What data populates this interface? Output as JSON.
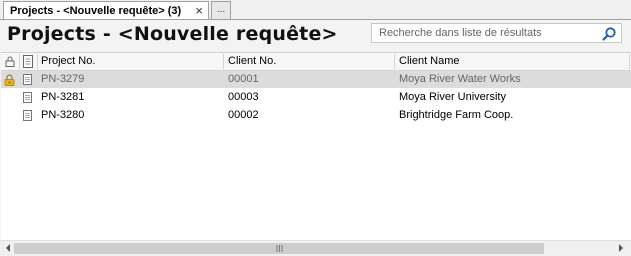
{
  "tab": {
    "label": "Projects - <Nouvelle requête> (3)",
    "close_glyph": "×",
    "more_glyph": "..."
  },
  "header": {
    "title": "Projects - <Nouvelle requête>"
  },
  "search": {
    "placeholder": "Recherche dans liste de résultats"
  },
  "grid": {
    "columns": {
      "lock": "lock-icon",
      "doc": "document-icon",
      "project_no": "Project No.",
      "client_no": "Client No.",
      "client_name": "Client Name"
    },
    "rows": [
      {
        "project_no": "PN-3279",
        "client_no": "00001",
        "client_name": "Moya River Water Works",
        "locked": true,
        "selected": true
      },
      {
        "project_no": "PN-3281",
        "client_no": "00003",
        "client_name": "Moya River University",
        "locked": false,
        "selected": false
      },
      {
        "project_no": "PN-3280",
        "client_no": "00002",
        "client_name": "Brightridge Farm Coop.",
        "locked": false,
        "selected": false
      }
    ]
  },
  "colors": {
    "selected_row": "#dcdcdc",
    "lock_icon": "#d9a520",
    "search_icon": "#1e5fa8"
  }
}
